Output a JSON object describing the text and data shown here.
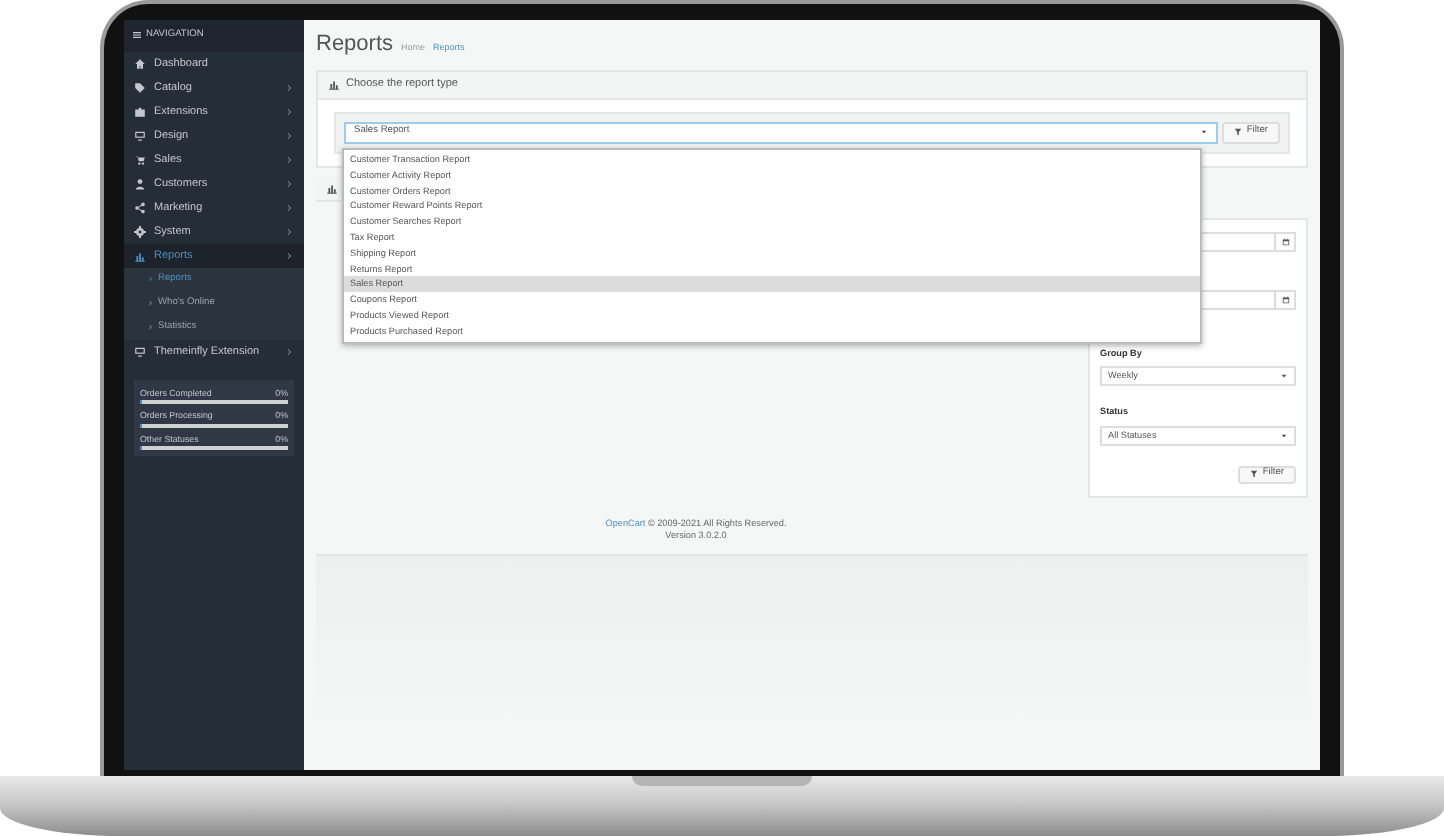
{
  "sidebar": {
    "header": "NAVIGATION",
    "items": [
      {
        "label": "Dashboard",
        "has_children": false,
        "selected": false
      },
      {
        "label": "Catalog",
        "has_children": true,
        "selected": false
      },
      {
        "label": "Extensions",
        "has_children": true,
        "selected": false
      },
      {
        "label": "Design",
        "has_children": true,
        "selected": false
      },
      {
        "label": "Sales",
        "has_children": true,
        "selected": false
      },
      {
        "label": "Customers",
        "has_children": true,
        "selected": false
      },
      {
        "label": "Marketing",
        "has_children": true,
        "selected": false
      },
      {
        "label": "System",
        "has_children": true,
        "selected": false
      },
      {
        "label": "Reports",
        "has_children": true,
        "selected": true,
        "children": [
          {
            "label": "Reports",
            "selected": true
          },
          {
            "label": "Who's Online",
            "selected": false
          },
          {
            "label": "Statistics",
            "selected": false
          }
        ]
      },
      {
        "label": "Themeinfly Extension",
        "has_children": true,
        "selected": false
      }
    ],
    "stats": [
      {
        "label": "Orders Completed",
        "value": "0%",
        "level": 0
      },
      {
        "label": "Orders Processing",
        "value": "0%",
        "level": 0
      },
      {
        "label": "Other Statuses",
        "value": "0%",
        "level": 0
      }
    ]
  },
  "page": {
    "title": "Reports",
    "breadcrumb": [
      "Home",
      "Reports"
    ]
  },
  "report_panel": {
    "heading": "Choose the report type",
    "select_value": "Sales Report",
    "filter_button": "Filter",
    "dropdown_open": true,
    "options": [
      {
        "label": "Customer Transaction Report",
        "selected": false
      },
      {
        "label": "Customer Activity Report",
        "selected": false
      },
      {
        "label": "Customer Orders Report",
        "selected": false
      },
      {
        "label": "Customer Reward Points Report",
        "selected": false
      },
      {
        "label": "Customer Searches Report",
        "selected": false
      },
      {
        "label": "Tax Report",
        "selected": false
      },
      {
        "label": "Shipping Report",
        "selected": false
      },
      {
        "label": "Returns Report",
        "selected": false
      },
      {
        "label": "Sales Report",
        "selected": true
      },
      {
        "label": "Coupons Report",
        "selected": false
      },
      {
        "label": "Products Viewed Report",
        "selected": false
      },
      {
        "label": "Products Purchased Report",
        "selected": false
      }
    ]
  },
  "filter_panel": {
    "fields": [
      {
        "kind": "date"
      },
      {
        "kind": "date"
      },
      {
        "kind": "select",
        "label": "Group By",
        "value": "Weekly"
      },
      {
        "kind": "select",
        "label": "Status",
        "value": "All Statuses"
      }
    ],
    "button": "Filter"
  },
  "footer": {
    "link": "OpenCart",
    "copyright": "© 2009-2021 All Rights Reserved.",
    "version": "Version 3.0.2.0"
  }
}
